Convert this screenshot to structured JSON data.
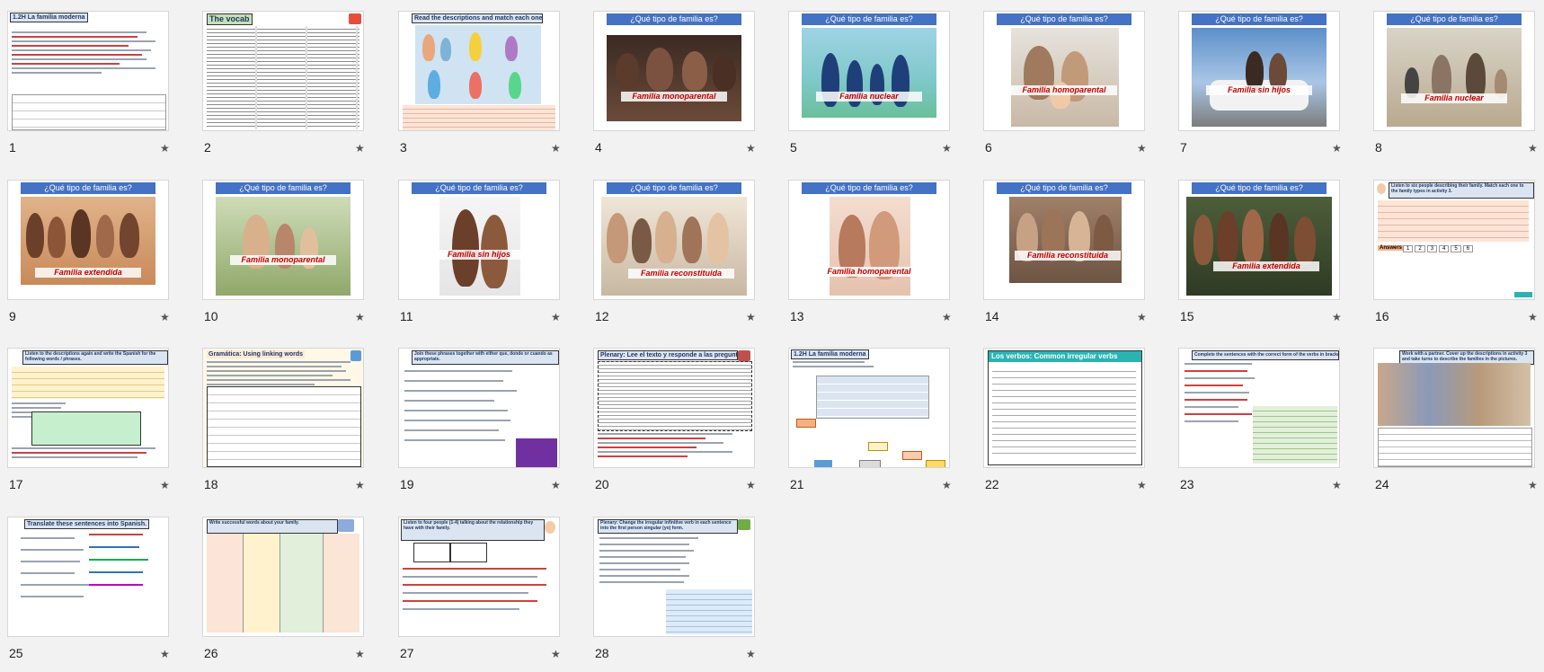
{
  "accent": "#4472c4",
  "caption_color": "#c00000",
  "star_icon": "★",
  "slides": [
    {
      "n": "1",
      "title": "1.2H La familia moderna",
      "kind": "text"
    },
    {
      "n": "2",
      "title": "The vocab",
      "kind": "text"
    },
    {
      "n": "3",
      "title": "Read the descriptions and match each one to the correct family picture.",
      "kind": "text"
    },
    {
      "n": "4",
      "title": "¿Qué tipo de familia es?",
      "caption": "Familia monoparental",
      "kind": "photo"
    },
    {
      "n": "5",
      "title": "¿Qué tipo de familia es?",
      "caption": "Familia nuclear",
      "kind": "photo"
    },
    {
      "n": "6",
      "title": "¿Qué tipo de familia es?",
      "caption": "Familia homoparental",
      "kind": "photo"
    },
    {
      "n": "7",
      "title": "¿Qué tipo de familia es?",
      "caption": "Familia sin hijos",
      "kind": "photo"
    },
    {
      "n": "8",
      "title": "¿Qué tipo de familia es?",
      "caption": "Familia nuclear",
      "kind": "photo"
    },
    {
      "n": "9",
      "title": "¿Qué tipo de familia es?",
      "caption": "Familia extendida",
      "kind": "photo"
    },
    {
      "n": "10",
      "title": "¿Qué tipo de familia es?",
      "caption": "Familia monoparental",
      "kind": "photo"
    },
    {
      "n": "11",
      "title": "¿Qué tipo de familia es?",
      "caption": "Familia sin hijos",
      "kind": "photo"
    },
    {
      "n": "12",
      "title": "¿Qué tipo de familia es?",
      "caption": "Familia reconstituida",
      "kind": "photo"
    },
    {
      "n": "13",
      "title": "¿Qué tipo de familia es?",
      "caption": "Familia homoparental",
      "kind": "photo"
    },
    {
      "n": "14",
      "title": "¿Qué tipo de familia es?",
      "caption": "Familia reconstituida",
      "kind": "photo"
    },
    {
      "n": "15",
      "title": "¿Qué tipo de familia es?",
      "caption": "Familia extendida",
      "kind": "photo"
    },
    {
      "n": "16",
      "title": "Listen to six people describing their family. Match each one to the family types in activity 3.",
      "kind": "text",
      "answers_label": "Answers",
      "answers": [
        "1",
        "2",
        "3",
        "4",
        "5",
        "6"
      ]
    },
    {
      "n": "17",
      "title": "Listen to the descriptions again and write the Spanish for the following words / phrases.",
      "kind": "text"
    },
    {
      "n": "18",
      "title": "Gramática: Using linking words",
      "kind": "text"
    },
    {
      "n": "19",
      "title": "Join these phrases together with either que, donde or cuando as appropriate.",
      "kind": "text"
    },
    {
      "n": "20",
      "title": "Plenary: Lee el texto y responde a las preguntas en español.",
      "kind": "text"
    },
    {
      "n": "21",
      "title": "1.2H La familia moderna",
      "kind": "text"
    },
    {
      "n": "22",
      "title": "Los verbos: Common irregular verbs",
      "kind": "text"
    },
    {
      "n": "23",
      "title": "Complete the sentences with the correct form of the verbs in brackets.",
      "kind": "text"
    },
    {
      "n": "24",
      "title": "Work with a partner. Cover up the descriptions in activity 3 and take turns to describe the families in the pictures.",
      "kind": "text"
    },
    {
      "n": "25",
      "title": "Translate these sentences into Spanish.",
      "kind": "text"
    },
    {
      "n": "26",
      "title": "Write successful words about your family.",
      "kind": "text"
    },
    {
      "n": "27",
      "title": "Listen to four people (1-4) talking about the relationship they have with their family.",
      "kind": "text"
    },
    {
      "n": "28",
      "title": "Plenary: Change the irregular infinitive verb in each sentence into the first person singular (yo) form.",
      "kind": "text"
    }
  ]
}
